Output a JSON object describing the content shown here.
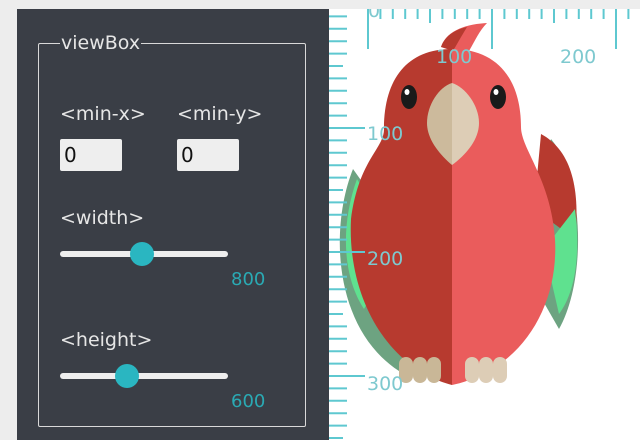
{
  "panel": {
    "legend": "viewBox",
    "min_x_label": "<min-x>",
    "min_y_label": "<min-y>",
    "min_x_value": "0",
    "min_y_value": "0",
    "width_label": "<width>",
    "width_value": "800",
    "width_level": 0.49,
    "height_label": "<height>",
    "height_value": "600",
    "height_level": 0.4
  },
  "ruler": {
    "x_labels": [
      "0",
      "100",
      "200"
    ],
    "y_labels": [
      "100",
      "200",
      "300"
    ]
  },
  "colors": {
    "accent": "#2ab6c1",
    "panel_bg": "#3a3e46",
    "parrot_dark_red": "#b73a2f",
    "parrot_light_red": "#ea5c5c",
    "wing_green": "#5fe18f",
    "wing_dark_green": "#6da381",
    "beak": "#d9cab4",
    "ruler": "#5ec8d0"
  },
  "illustration": {
    "subject": "parrot-illustration"
  }
}
